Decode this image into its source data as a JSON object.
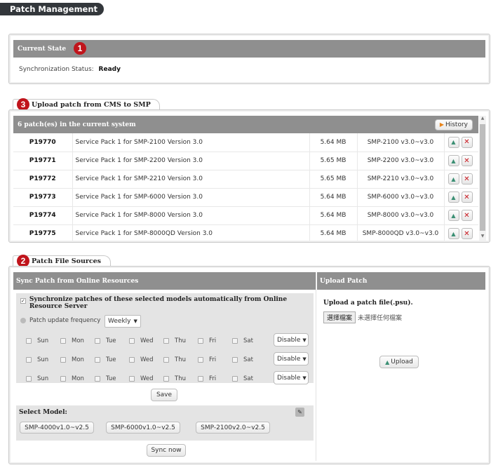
{
  "page": {
    "title": "Patch Management"
  },
  "current_state": {
    "badge": "1",
    "header": "Current State",
    "status_label": "Synchronization Status:",
    "status_value": "Ready"
  },
  "upload_cms": {
    "badge": "3",
    "tab_label": "Upload patch from CMS to SMP",
    "header": "6 patch(es) in the current system",
    "history_label": "History",
    "patches": [
      {
        "id": "P19770",
        "name": "Service Pack 1 for SMP-2100 Version 3.0",
        "size": "5.64 MB",
        "model": "SMP-2100 v3.0~v3.0"
      },
      {
        "id": "P19771",
        "name": "Service Pack 1 for SMP-2200 Version 3.0",
        "size": "5.65 MB",
        "model": "SMP-2200 v3.0~v3.0"
      },
      {
        "id": "P19772",
        "name": "Service Pack 1 for SMP-2210 Version 3.0",
        "size": "5.65 MB",
        "model": "SMP-2210 v3.0~v3.0"
      },
      {
        "id": "P19773",
        "name": "Service Pack 1 for SMP-6000 Version 3.0",
        "size": "5.64 MB",
        "model": "SMP-6000 v3.0~v3.0"
      },
      {
        "id": "P19774",
        "name": "Service Pack 1 for SMP-8000 Version 3.0",
        "size": "5.64 MB",
        "model": "SMP-8000 v3.0~v3.0"
      },
      {
        "id": "P19775",
        "name": "Service Pack 1 for SMP-8000QD Version 3.0",
        "size": "5.64 MB",
        "model": "SMP-8000QD v3.0~v3.0"
      }
    ]
  },
  "sources": {
    "badge": "2",
    "tab_label": "Patch File Sources",
    "sync": {
      "header": "Sync Patch from Online Resources",
      "auto_sync_label": "Synchronize patches of these selected models automatically from Online Resource Server",
      "auto_sync_checked": true,
      "frequency_label": "Patch update frequency",
      "frequency_value": "Weekly",
      "days": [
        "Sun",
        "Mon",
        "Tue",
        "Wed",
        "Thu",
        "Fri",
        "Sat"
      ],
      "schedule_rows": [
        {
          "value": "Disable"
        },
        {
          "value": "Disable"
        },
        {
          "value": "Disable"
        }
      ],
      "save_label": "Save",
      "select_model_label": "Select Model:",
      "models": [
        "SMP-4000v1.0~v2.5",
        "SMP-6000v1.0~v2.5",
        "SMP-2100v2.0~v2.5"
      ],
      "sync_now_label": "Sync now"
    },
    "upload": {
      "header": "Upload Patch",
      "instruction": "Upload a patch file(.psu).",
      "choose_file_label": "選擇檔案",
      "no_file_label": "未選擇任何檔案",
      "upload_label": "Upload"
    }
  }
}
